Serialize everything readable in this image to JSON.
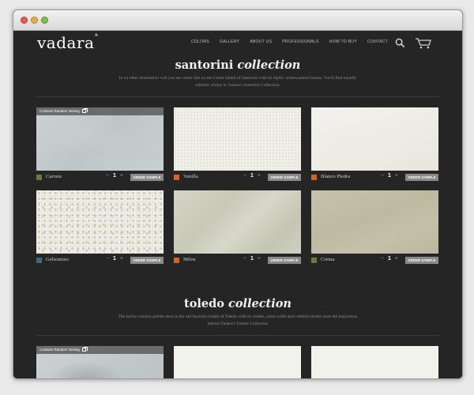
{
  "window": {
    "controls": [
      "close",
      "minimize",
      "zoom"
    ]
  },
  "header": {
    "logo": "vadara",
    "logo_mark": "®",
    "nav": [
      "COLORS",
      "GALLERY",
      "ABOUT US",
      "PROFESSIONALS",
      "HOW TO BUY",
      "CONTACT"
    ],
    "icons": [
      "search-icon",
      "cart-icon"
    ]
  },
  "collections": [
    {
      "title": "santorini",
      "title_suffix": "collection",
      "description": "In no other destination will you see white like on the Greek island of Santorini with its idyllic whitewashed houses. You'll find equally sublime whites in Vadara's Santorini Collection.",
      "items": [
        {
          "name": "Carrara",
          "qty": "1",
          "chip": "#6b7a3a",
          "badge": "Contains Random Veining",
          "texture": "carrara"
        },
        {
          "name": "Vanilla",
          "qty": "1",
          "chip": "#d2642a",
          "badge": "",
          "texture": "vanilla"
        },
        {
          "name": "Blanco Piedra",
          "qty": "1",
          "chip": "#d2642a",
          "badge": "",
          "texture": "blanco"
        },
        {
          "name": "Gelsomino",
          "qty": "1",
          "chip": "#3d6a80",
          "badge": "",
          "texture": "gelsomino"
        },
        {
          "name": "Milos",
          "qty": "1",
          "chip": "#d2642a",
          "badge": "",
          "texture": "milos"
        },
        {
          "name": "Crema",
          "qty": "1",
          "chip": "#6b7a3a",
          "badge": "",
          "texture": "crema"
        }
      ]
    },
    {
      "title": "toledo",
      "title_suffix": "collection",
      "description": "The earthy-creamy palette seen in the old Spanish citadel of Toledo with its castles, stone walls and cobbled streets were the inspiration behind Vadara's Toledo Collection",
      "items": [
        {
          "badge": "Contains Random Veining",
          "texture": "carrara2"
        },
        {
          "badge": "",
          "texture": "white"
        },
        {
          "badge": "",
          "texture": "white"
        }
      ]
    }
  ],
  "labels": {
    "order_sample": "ORDER SAMPLE",
    "minus": "−",
    "plus": "+"
  }
}
